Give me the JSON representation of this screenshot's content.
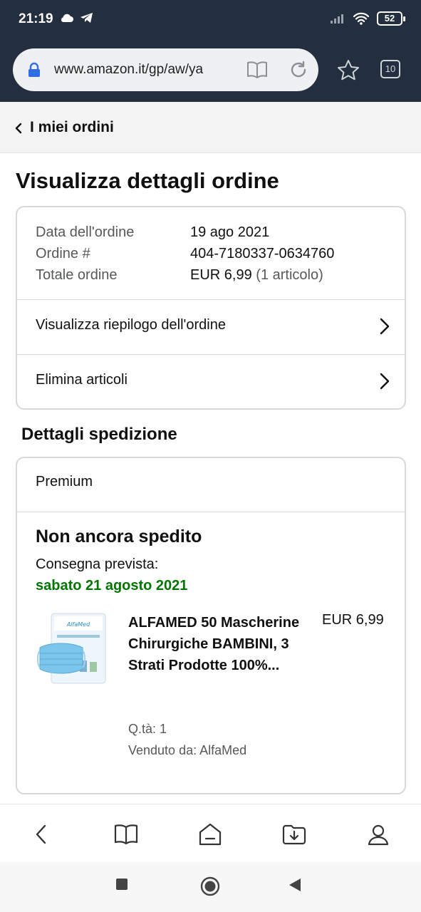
{
  "status_bar": {
    "time": "21:19",
    "battery": "52"
  },
  "browser": {
    "url": "www.amazon.it/gp/aw/ya",
    "tab_count": "10"
  },
  "breadcrumb": {
    "label": "I miei ordini"
  },
  "page": {
    "title": "Visualizza dettagli ordine"
  },
  "order_summary": {
    "rows": [
      {
        "label": "Data dell'ordine",
        "value": "19 ago 2021"
      },
      {
        "label": "Ordine #",
        "value": "404-7180337-0634760"
      },
      {
        "label": "Totale ordine",
        "value": "EUR 6,99",
        "extra": "(1 articolo)"
      }
    ],
    "links": [
      {
        "label": "Visualizza riepilogo dell'ordine"
      },
      {
        "label": "Elimina articoli"
      }
    ]
  },
  "shipping": {
    "section_title": "Dettagli spedizione",
    "service": "Premium",
    "status": "Non ancora spedito",
    "delivery_label": "Consegna prevista:",
    "delivery_date": "sabato 21 agosto 2021",
    "item": {
      "title": "ALFAMED 50 Mascherine Chirurgiche BAMBINI, 3 Strati Prodotte 100%...",
      "price": "EUR 6,99",
      "quantity": "Q.tà: 1",
      "seller": "Venduto da: AlfaMed",
      "package_brand": "AlfaMed"
    }
  },
  "colors": {
    "chrome_bg": "#232f3e",
    "delivery_green": "#007600",
    "lock_blue": "#2f6fe6"
  }
}
